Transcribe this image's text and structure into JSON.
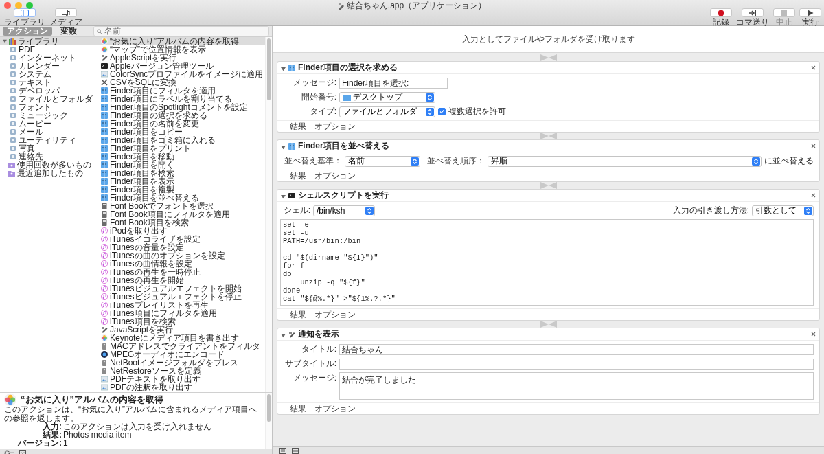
{
  "window": {
    "title": "結合ちゃん.app（アプリケーション）"
  },
  "toolbar_left": [
    {
      "label": "ライブラリ",
      "kind": "library",
      "selected": true
    },
    {
      "label": "メディア",
      "kind": "media",
      "selected": false
    }
  ],
  "toolbar_right": [
    {
      "label": "記録",
      "kind": "record",
      "disabled": false
    },
    {
      "label": "コマ送り",
      "kind": "step",
      "disabled": false
    },
    {
      "label": "中止",
      "kind": "stop",
      "disabled": true
    },
    {
      "label": "実行",
      "kind": "run",
      "disabled": false
    }
  ],
  "mode_tabs": [
    {
      "label": "アクション",
      "selected": true
    },
    {
      "label": "変数",
      "selected": false
    }
  ],
  "search": {
    "placeholder": "名前"
  },
  "library": [
    {
      "label": "ライブラリ",
      "kind": "library",
      "selected": true,
      "expanded": true,
      "children": [
        {
          "label": "PDF",
          "kind": "category",
          "selected": false
        },
        {
          "label": "インターネット",
          "kind": "category",
          "selected": false
        },
        {
          "label": "カレンダー",
          "kind": "category",
          "selected": false
        },
        {
          "label": "システム",
          "kind": "category",
          "selected": false
        },
        {
          "label": "テキスト",
          "kind": "category",
          "selected": false
        },
        {
          "label": "デベロッパ",
          "kind": "category",
          "selected": false
        },
        {
          "label": "ファイルとフォルダ",
          "kind": "category",
          "selected": false
        },
        {
          "label": "フォント",
          "kind": "category",
          "selected": false
        },
        {
          "label": "ミュージック",
          "kind": "category",
          "selected": false
        },
        {
          "label": "ムービー",
          "kind": "category",
          "selected": false
        },
        {
          "label": "メール",
          "kind": "category",
          "selected": false
        },
        {
          "label": "ユーティリティ",
          "kind": "category",
          "selected": false
        },
        {
          "label": "写真",
          "kind": "category",
          "selected": false
        },
        {
          "label": "連絡先",
          "kind": "category",
          "selected": false
        }
      ]
    },
    {
      "label": "使用回数が多いもの",
      "kind": "smart",
      "selected": false
    },
    {
      "label": "最近追加したもの",
      "kind": "smart",
      "selected": false
    }
  ],
  "actions": [
    {
      "label": "“お気に入り”アルバムの内容を取得",
      "kind": "photos",
      "selected": true
    },
    {
      "label": "“マップ”で位置情報を表示",
      "kind": "photos",
      "selected": false
    },
    {
      "label": "AppleScriptを実行",
      "kind": "script",
      "selected": false
    },
    {
      "label": "Appleバージョン管理ツール",
      "kind": "terminal",
      "selected": false
    },
    {
      "label": "ColorSyncプロファイルをイメージに適用",
      "kind": "image",
      "selected": false
    },
    {
      "label": "CSVをSQLに変換",
      "kind": "tool",
      "selected": false
    },
    {
      "label": "Finder項目にフィルタを適用",
      "kind": "finder",
      "selected": false
    },
    {
      "label": "Finder項目にラベルを割り当てる",
      "kind": "finder",
      "selected": false
    },
    {
      "label": "Finder項目のSpotlightコメントを設定",
      "kind": "finder",
      "selected": false
    },
    {
      "label": "Finder項目の選択を求める",
      "kind": "finder",
      "selected": false
    },
    {
      "label": "Finder項目の名前を変更",
      "kind": "finder",
      "selected": false
    },
    {
      "label": "Finder項目をコピー",
      "kind": "finder",
      "selected": false
    },
    {
      "label": "Finder項目をゴミ箱に入れる",
      "kind": "finder",
      "selected": false
    },
    {
      "label": "Finder項目をプリント",
      "kind": "finder",
      "selected": false
    },
    {
      "label": "Finder項目を移動",
      "kind": "finder",
      "selected": false
    },
    {
      "label": "Finder項目を開く",
      "kind": "finder",
      "selected": false
    },
    {
      "label": "Finder項目を検索",
      "kind": "finder",
      "selected": false
    },
    {
      "label": "Finder項目を表示",
      "kind": "finder",
      "selected": false
    },
    {
      "label": "Finder項目を複製",
      "kind": "finder",
      "selected": false
    },
    {
      "label": "Finder項目を並べ替える",
      "kind": "finder",
      "selected": false
    },
    {
      "label": "Font Bookでフォントを選択",
      "kind": "book",
      "selected": false
    },
    {
      "label": "Font Book項目にフィルタを適用",
      "kind": "book",
      "selected": false
    },
    {
      "label": "Font Book項目を検索",
      "kind": "book",
      "selected": false
    },
    {
      "label": "iPodを取り出す",
      "kind": "music",
      "selected": false
    },
    {
      "label": "iTunesイコライザを設定",
      "kind": "music",
      "selected": false
    },
    {
      "label": "iTunesの音量を設定",
      "kind": "music",
      "selected": false
    },
    {
      "label": "iTunesの曲のオプションを設定",
      "kind": "music",
      "selected": false
    },
    {
      "label": "iTunesの曲情報を設定",
      "kind": "music",
      "selected": false
    },
    {
      "label": "iTunesの再生を一時停止",
      "kind": "music",
      "selected": false
    },
    {
      "label": "iTunesの再生を開始",
      "kind": "music",
      "selected": false
    },
    {
      "label": "iTunesビジュアルエフェクトを開始",
      "kind": "music",
      "selected": false
    },
    {
      "label": "iTunesビジュアルエフェクトを停止",
      "kind": "music",
      "selected": false
    },
    {
      "label": "iTunesプレイリストを再生",
      "kind": "music",
      "selected": false
    },
    {
      "label": "iTunes項目にフィルタを適用",
      "kind": "music",
      "selected": false
    },
    {
      "label": "iTunes項目を検索",
      "kind": "music",
      "selected": false
    },
    {
      "label": "JavaScriptを実行",
      "kind": "script",
      "selected": false
    },
    {
      "label": "Keynoteにメディア項目を書き出す",
      "kind": "photos",
      "selected": false
    },
    {
      "label": "MACアドレスでクライアントをフィルタ",
      "kind": "server",
      "selected": false
    },
    {
      "label": "MPEGオーディオにエンコード",
      "kind": "movie",
      "selected": false
    },
    {
      "label": "NetBootイメージフォルダをブレス",
      "kind": "server",
      "selected": false
    },
    {
      "label": "NetRestoreソースを定義",
      "kind": "server",
      "selected": false
    },
    {
      "label": "PDFテキストを取り出す",
      "kind": "image",
      "selected": false
    },
    {
      "label": "PDFの注釈を取り出す",
      "kind": "image",
      "selected": false
    }
  ],
  "description": {
    "title": "“お気に入り”アルバムの内容を取得",
    "text": "このアクションは、“お気に入り”アルバムに含まれるメディア項目への参照を返します。",
    "meta": [
      {
        "label": "入力:",
        "value": "このアクションは入力を受け入れません"
      },
      {
        "label": "結果:",
        "value": "Photos media item"
      },
      {
        "label": "バージョン:",
        "value": "1"
      }
    ]
  },
  "workflow": {
    "input": "入力としてファイルやフォルダを受け取ります",
    "steps": [
      {
        "title": "Finder項目の選択を求める",
        "kind": "finder",
        "expanded": true,
        "rows": [
          {
            "kind": "text",
            "label": "メッセージ:",
            "value": "Finder項目を選択:"
          },
          {
            "kind": "popup",
            "label": "開始番号:",
            "value": "デスクトップ",
            "folder": true
          },
          {
            "kind": "popup",
            "label": "タイプ:",
            "value": "ファイルとフォルダ",
            "checkbox": {
              "label": "複数選択を許可",
              "checked": true
            }
          }
        ],
        "footer": [
          "結果",
          "オプション"
        ]
      },
      {
        "title": "Finder項目を並べ替える",
        "kind": "finder",
        "expanded": true,
        "rows": [
          {
            "kind": "sort",
            "label": "並べ替え基準：",
            "value": "名前",
            "label2": "並べ替え順序：",
            "value2": "昇順",
            "suffix": "に並べ替える"
          }
        ],
        "footer": [
          "結果",
          "オプション"
        ]
      },
      {
        "title": "シェルスクリプトを実行",
        "kind": "terminal",
        "expanded": true,
        "rows": [
          {
            "kind": "shell",
            "label": "シェル:",
            "value": "/bin/ksh",
            "label2": "入力の引き渡し方法:",
            "value2": "引数として"
          },
          {
            "kind": "code",
            "value": "set -e\nset -u\nPATH=/usr/bin:/bin\n\ncd \"$(dirname \"${1}\")\"\nfor f\ndo\n    unzip -q \"${f}\"\ndone\ncat \"${@%.*}\" >\"${1%.?.*}\""
          }
        ],
        "footer": [
          "結果",
          "オプション"
        ]
      },
      {
        "title": "通知を表示",
        "kind": "script",
        "expanded": true,
        "rows": [
          {
            "kind": "line",
            "label": "タイトル:",
            "value": "結合ちゃん"
          },
          {
            "kind": "line",
            "label": "サブタイトル:"
          },
          {
            "kind": "textarea",
            "label": "メッセージ:",
            "value": "結合が完了しました"
          }
        ],
        "footer": [
          "結果",
          "オプション"
        ]
      }
    ]
  }
}
